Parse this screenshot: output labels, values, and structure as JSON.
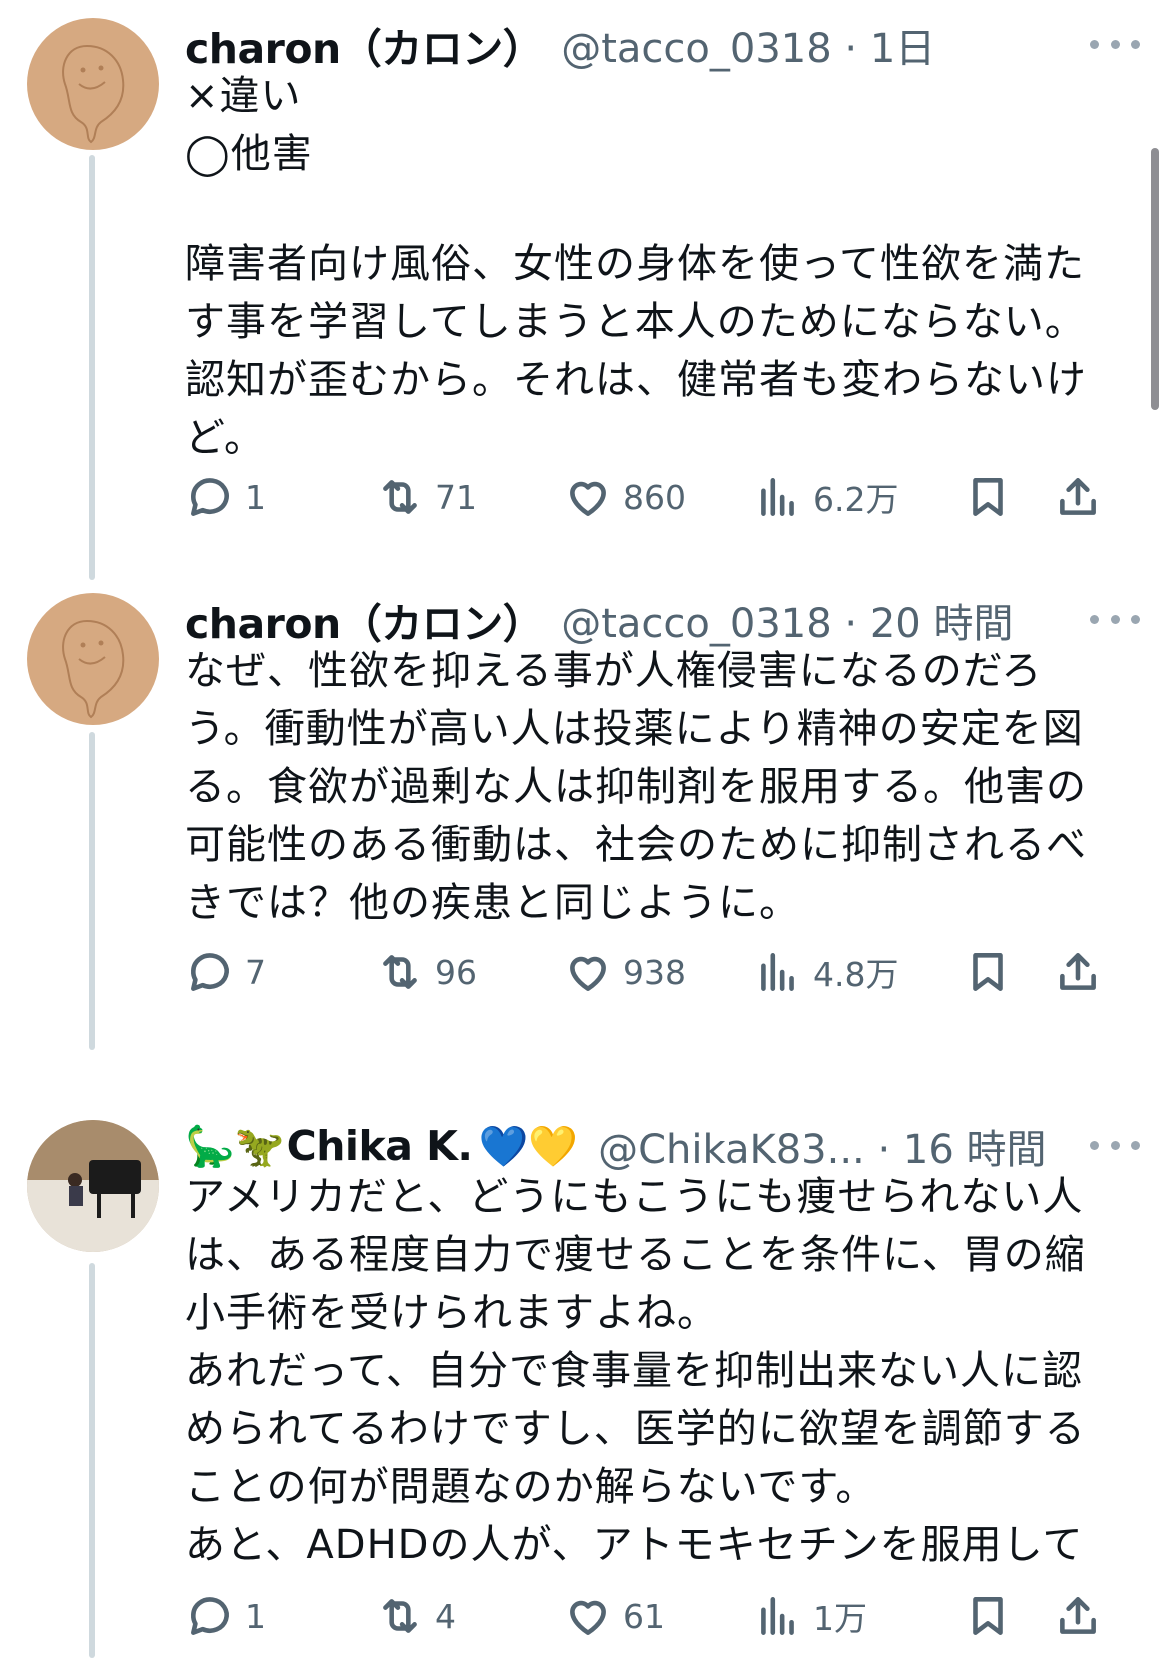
{
  "tweets": [
    {
      "name": "charon（カロン）",
      "handle": "@tacco_0318",
      "time": "1日",
      "lines": [
        "×違い",
        "◯他害",
        "",
        "障害者向け風俗、女性の身体を使って性欲を満た",
        "す事を学習してしまうと本人のためにならない。",
        "認知が歪むから。それは、健常者も変わらないけ",
        "ど。"
      ],
      "actions": {
        "reply": "1",
        "retweet": "71",
        "like": "860",
        "views": "6.2万"
      }
    },
    {
      "name": "charon（カロン）",
      "handle": "@tacco_0318",
      "time": "20 時間",
      "lines": [
        "なぜ、性欲を抑える事が人権侵害になるのだろ",
        "う。衝動性が高い人は投薬により精神の安定を図",
        "る。食欲が過剰な人は抑制剤を服用する。他害の",
        "可能性のある衝動は、社会のために抑制されるべ",
        "きでは？他の疾患と同じように。"
      ],
      "actions": {
        "reply": "7",
        "retweet": "96",
        "like": "938",
        "views": "4.8万"
      }
    },
    {
      "name": "Chika K.",
      "name_emojis_before": "🦕🦖",
      "name_emojis_after": "💙💛",
      "handle": "@ChikaK83...",
      "time": "16 時間",
      "lines": [
        "アメリカだと、どうにもこうにも痩せられない人",
        "は、ある程度自力で痩せることを条件に、胃の縮",
        "小手術を受けられますよね。",
        "あれだって、自分で食事量を抑制出来ない人に認",
        "められてるわけですし、医学的に欲望を調節する",
        "ことの何が問題なのか解らないです。",
        "あと、ADHDの人が、アトモキセチンを服用して"
      ],
      "actions": {
        "reply": "1",
        "retweet": "4",
        "like": "61",
        "views": "1万"
      }
    }
  ],
  "icons": {
    "more": "more-horizontal-icon",
    "reply": "reply-bubble-icon",
    "retweet": "retweet-icon",
    "like": "heart-icon",
    "views": "views-bar-chart-icon",
    "bookmark": "bookmark-icon",
    "share": "share-upload-icon"
  },
  "colors": {
    "text": "#0f1419",
    "secondary": "#536471",
    "line": "#cfd9de"
  }
}
